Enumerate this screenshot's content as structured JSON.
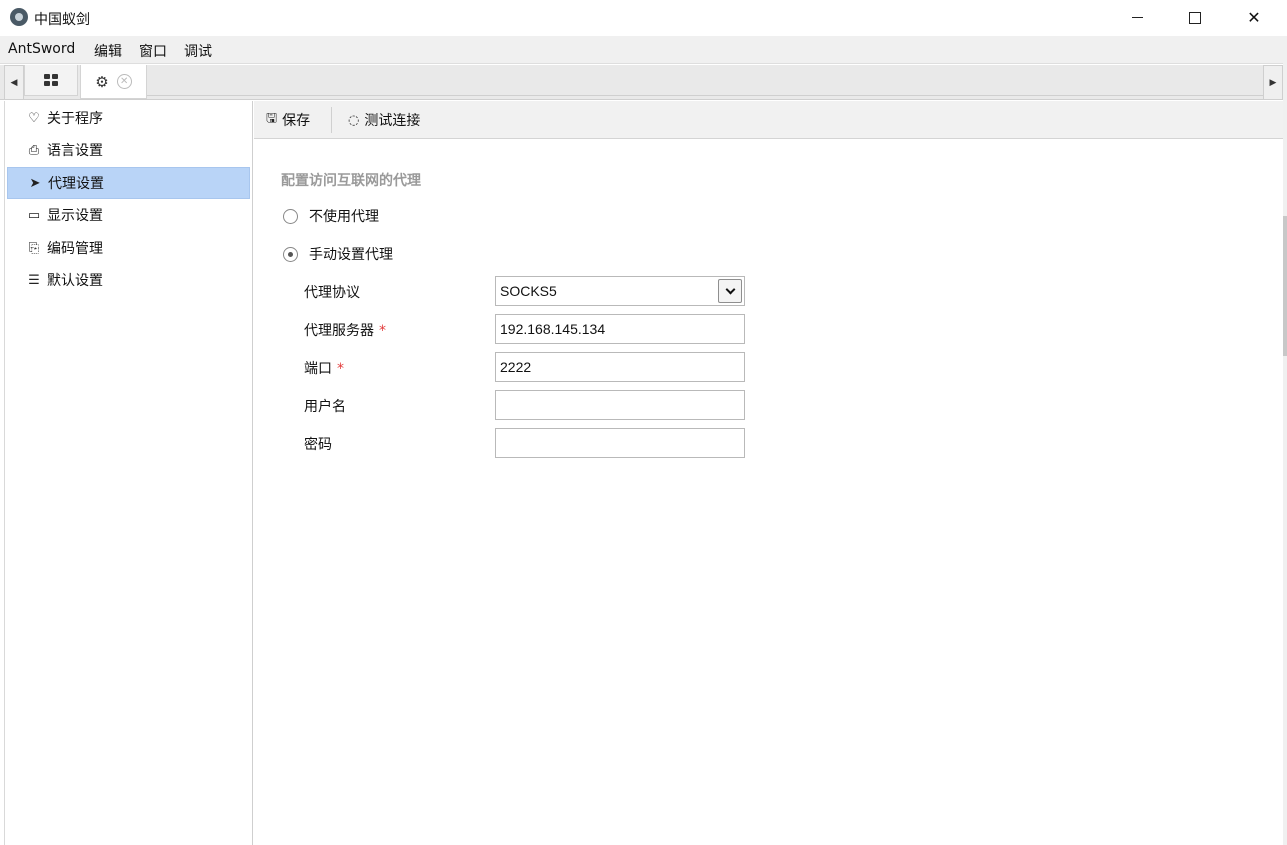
{
  "window": {
    "title": "中国蚁剑"
  },
  "menubar": {
    "items": [
      "AntSword",
      "编辑",
      "窗口",
      "调试"
    ]
  },
  "sidebar": {
    "items": [
      {
        "label": "关于程序",
        "icon": "heart-icon",
        "glyph": "♡"
      },
      {
        "label": "语言设置",
        "icon": "language-icon",
        "glyph": "⎙"
      },
      {
        "label": "代理设置",
        "icon": "paper-plane-icon",
        "glyph": "➤"
      },
      {
        "label": "显示设置",
        "icon": "monitor-icon",
        "glyph": "▭"
      },
      {
        "label": "编码管理",
        "icon": "code-file-icon",
        "glyph": "⎘"
      },
      {
        "label": "默认设置",
        "icon": "sliders-icon",
        "glyph": "☰"
      }
    ],
    "active_index": 2
  },
  "toolbar": {
    "save_label": "保存",
    "test_label": "测试连接"
  },
  "proxy": {
    "section_title": "配置访问互联网的代理",
    "no_proxy_label": "不使用代理",
    "manual_proxy_label": "手动设置代理",
    "selected_mode": "manual",
    "fields": {
      "protocol": {
        "label": "代理协议",
        "value": "SOCKS5",
        "required": false
      },
      "server": {
        "label": "代理服务器",
        "value": "192.168.145.134",
        "required": true
      },
      "port": {
        "label": "端口",
        "value": "2222",
        "required": true
      },
      "username": {
        "label": "用户名",
        "value": "",
        "required": false
      },
      "password": {
        "label": "密码",
        "value": "",
        "required": false
      }
    },
    "required_marker": "*"
  },
  "colors": {
    "active_item_bg": "#b9d4f7",
    "required_marker": "#e23b3b",
    "section_title": "#9a9a9a"
  }
}
